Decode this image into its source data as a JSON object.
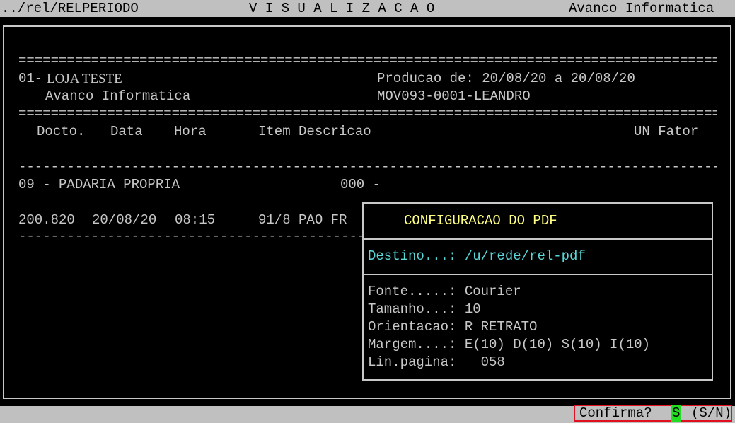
{
  "topbar": {
    "path": "../rel/RELPERIODO",
    "title": "V I S U A L I Z A C A O",
    "company": "Avanco Informatica"
  },
  "report": {
    "rule_double": "==================================================================================================================",
    "rule_single": "------------------------------------------------------------------------------------------------------------------",
    "store_code": "01-",
    "store_name": "LOJA TESTE",
    "company": "Avanco Informatica",
    "production_label": "Producao de: 20/08/20 a 20/08/20",
    "user_ref": "MOV093-0001-LEANDRO",
    "columns": {
      "docto": "Docto.",
      "data": "Data",
      "hora": "Hora",
      "item_desc": "Item Descricao",
      "un_fator": "UN Fator"
    },
    "group_line": "09 - PADARIA PROPRIA",
    "group_code": "000 -",
    "row": {
      "docto": "200.820",
      "data": "20/08/20",
      "hora": "08:15",
      "item": "91/8 PAO FR"
    }
  },
  "dialog": {
    "title": "CONFIGURACAO DO PDF",
    "destino": "Destino...: /u/rede/rel-pdf",
    "fonte": "Fonte.....: Courier",
    "tamanho": "Tamanho...: 10",
    "orientacao": "Orientacao: R RETRATO",
    "margem": "Margem....: E(10) D(10) S(10) I(10)",
    "linhas": "Lin.pagina:   058"
  },
  "confirm": {
    "label": "Confirma?",
    "value": "S",
    "options": "(S/N)"
  }
}
